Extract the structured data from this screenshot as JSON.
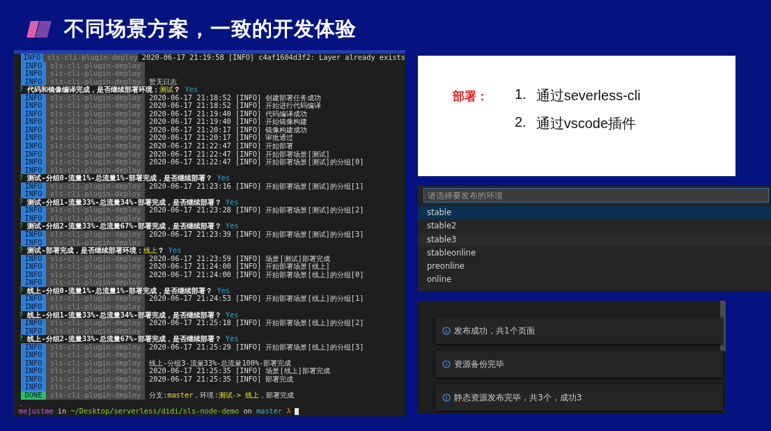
{
  "title": "不同场景方案，一致的开发体验",
  "terminal": {
    "lines": [
      {
        "kind": "log",
        "level": "INFO",
        "source": "sls-cli-plugin-deploy",
        "message": "2020-06-17 21:19:58 [INFO] c4af1604d3f2: Layer already exists"
      },
      {
        "kind": "log",
        "level": "INFO",
        "source": "sls-cli-plugin-deploy"
      },
      {
        "kind": "log",
        "level": "INFO",
        "source": "sls-cli-plugin-deploy"
      },
      {
        "kind": "log",
        "level": "INFO",
        "source": "sls-cli-plugin-deploy",
        "message": "暂无日志"
      },
      {
        "kind": "prompt",
        "segments": [
          {
            "text": "?",
            "kind": "mark"
          },
          {
            "text": " 代码和镜像编译完成，是否继续部署环境：",
            "kind": "question"
          },
          {
            "text": "测试",
            "kind": "env"
          },
          {
            "text": "？",
            "kind": "question"
          },
          {
            "text": " Yes",
            "kind": "answer"
          }
        ]
      },
      {
        "kind": "log",
        "level": "INFO",
        "source": "sls-cli-plugin-deploy",
        "message": "2020-06-17 21:18:52 [INFO] 创建部署任务成功"
      },
      {
        "kind": "log",
        "level": "INFO",
        "source": "sls-cli-plugin-deploy",
        "message": "2020-06-17 21:18:52 [INFO] 开始进行代码编译"
      },
      {
        "kind": "log",
        "level": "INFO",
        "source": "sls-cli-plugin-deploy",
        "message": "2020-06-17 21:19:40 [INFO] 代码编译成功"
      },
      {
        "kind": "log",
        "level": "INFO",
        "source": "sls-cli-plugin-deploy",
        "message": "2020-06-17 21:19:40 [INFO] 开始镜像构建"
      },
      {
        "kind": "log",
        "level": "INFO",
        "source": "sls-cli-plugin-deploy",
        "message": "2020-06-17 21:20:17 [INFO] 镜像构建成功"
      },
      {
        "kind": "log",
        "level": "INFO",
        "source": "sls-cli-plugin-deploy",
        "message": "2020-06-17 21:20:17 [INFO] 审批通过"
      },
      {
        "kind": "log",
        "level": "INFO",
        "source": "sls-cli-plugin-deploy",
        "message": "2020-06-17 21:22:47 [INFO] 开始部署"
      },
      {
        "kind": "log",
        "level": "INFO",
        "source": "sls-cli-plugin-deploy",
        "message": "2020-06-17 21:22:47 [INFO] 开始部署场景[测试]"
      },
      {
        "kind": "log",
        "level": "INFO",
        "source": "sls-cli-plugin-deploy",
        "message": "2020-06-17 21:22:47 [INFO] 开始部署场景[测试]的分组[0]"
      },
      {
        "kind": "log",
        "level": "INFO",
        "source": "sls-cli-plugin-deploy"
      },
      {
        "kind": "prompt",
        "segments": [
          {
            "text": "?",
            "kind": "mark"
          },
          {
            "text": " 测试-分组0-流量1%-总流量1%-部署完成，是否继续部署？",
            "kind": "question"
          },
          {
            "text": " Yes",
            "kind": "answer"
          }
        ]
      },
      {
        "kind": "log",
        "level": "INFO",
        "source": "sls-cli-plugin-deploy",
        "message": "2020-06-17 21:23:16 [INFO] 开始部署场景[测试]的分组[1]"
      },
      {
        "kind": "log",
        "level": "INFO",
        "source": "sls-cli-plugin-deploy"
      },
      {
        "kind": "prompt",
        "segments": [
          {
            "text": "?",
            "kind": "mark"
          },
          {
            "text": " 测试-分组1-流量33%-总流量34%-部署完成，是否继续部署？",
            "kind": "question"
          },
          {
            "text": " Yes",
            "kind": "answer"
          }
        ]
      },
      {
        "kind": "log",
        "level": "INFO",
        "source": "sls-cli-plugin-deploy",
        "message": "2020-06-17 21:23:28 [INFO] 开始部署场景[测试]的分组[2]"
      },
      {
        "kind": "log",
        "level": "INFO",
        "source": "sls-cli-plugin-deploy"
      },
      {
        "kind": "prompt",
        "segments": [
          {
            "text": "?",
            "kind": "mark"
          },
          {
            "text": " 测试-分组2-流量33%-总流量67%-部署完成，是否继续部署？",
            "kind": "question"
          },
          {
            "text": " Yes",
            "kind": "answer"
          }
        ]
      },
      {
        "kind": "log",
        "level": "INFO",
        "source": "sls-cli-plugin-deploy",
        "message": "2020-06-17 21:23:39 [INFO] 开始部署场景[测试]的分组[3]"
      },
      {
        "kind": "log",
        "level": "INFO",
        "source": "sls-cli-plugin-deploy"
      },
      {
        "kind": "prompt",
        "segments": [
          {
            "text": "?",
            "kind": "mark"
          },
          {
            "text": " 测试-部署完成，是否继续部署环境：",
            "kind": "question"
          },
          {
            "text": "线上",
            "kind": "env"
          },
          {
            "text": "？",
            "kind": "question"
          },
          {
            "text": " Yes",
            "kind": "answer"
          }
        ]
      },
      {
        "kind": "log",
        "level": "INFO",
        "source": "sls-cli-plugin-deploy",
        "message": "2020-06-17 21:23:59 [INFO] 场景[测试]部署完成"
      },
      {
        "kind": "log",
        "level": "INFO",
        "source": "sls-cli-plugin-deploy",
        "message": "2020-06-17 21:24:00 [INFO] 开始部署场景[线上]"
      },
      {
        "kind": "log",
        "level": "INFO",
        "source": "sls-cli-plugin-deploy",
        "message": "2020-06-17 21:24:00 [INFO] 开始部署场景[线上]的分组[0]"
      },
      {
        "kind": "log",
        "level": "INFO",
        "source": "sls-cli-plugin-deploy"
      },
      {
        "kind": "prompt",
        "segments": [
          {
            "text": "?",
            "kind": "mark"
          },
          {
            "text": " 线上-分组0-流量1%-总流量1%-部署完成，是否继续部署？",
            "kind": "question"
          },
          {
            "text": " Yes",
            "kind": "answer"
          }
        ]
      },
      {
        "kind": "log",
        "level": "INFO",
        "source": "sls-cli-plugin-deploy",
        "message": "2020-06-17 21:24:53 [INFO] 开始部署场景[线上]的分组[1]"
      },
      {
        "kind": "log",
        "level": "INFO",
        "source": "sls-cli-plugin-deploy"
      },
      {
        "kind": "prompt",
        "segments": [
          {
            "text": "?",
            "kind": "mark"
          },
          {
            "text": " 线上-分组1-流量33%-总流量34%-部署完成，是否继续部署？",
            "kind": "question"
          },
          {
            "text": " Yes",
            "kind": "answer"
          }
        ]
      },
      {
        "kind": "log",
        "level": "INFO",
        "source": "sls-cli-plugin-deploy",
        "message": "2020-06-17 21:25:18 [INFO] 开始部署场景[线上]的分组[2]"
      },
      {
        "kind": "log",
        "level": "INFO",
        "source": "sls-cli-plugin-deploy"
      },
      {
        "kind": "prompt",
        "segments": [
          {
            "text": "?",
            "kind": "mark"
          },
          {
            "text": " 线上-分组2-流量33%-总流量67%-部署完成，是否继续部署？",
            "kind": "question"
          },
          {
            "text": " Yes",
            "kind": "answer"
          }
        ]
      },
      {
        "kind": "log",
        "level": "INFO",
        "source": "sls-cli-plugin-deploy",
        "message": "2020-06-17 21:25:29 [INFO] 开始部署场景[线上]的分组[3]"
      },
      {
        "kind": "log",
        "level": "INFO",
        "source": "sls-cli-plugin-deploy"
      },
      {
        "kind": "log",
        "level": "INFO",
        "source": "sls-cli-plugin-deploy",
        "message": "线上-分组3-流量33%-总流量100%-部署完成"
      },
      {
        "kind": "log",
        "level": "INFO",
        "source": "sls-cli-plugin-deploy",
        "message": "2020-06-17 21:25:35 [INFO] 场景[线上]部署完成"
      },
      {
        "kind": "log",
        "level": "INFO",
        "source": "sls-cli-plugin-deploy",
        "message": "2020-06-17 21:25:35 [INFO] 部署完成"
      },
      {
        "kind": "log",
        "level": "INFO",
        "source": "sls-cli-plugin-deploy"
      },
      {
        "kind": "log",
        "level": "DONE",
        "source": "sls-cli-plugin-deploy",
        "segments": [
          {
            "text": "分支:",
            "kind": "plain"
          },
          {
            "text": "master",
            "kind": "env"
          },
          {
            "text": "，环境:",
            "kind": "plain"
          },
          {
            "text": "测试-> 线上",
            "kind": "env"
          },
          {
            "text": "，部署完成",
            "kind": "plain"
          }
        ]
      },
      {
        "kind": "text",
        "segments": [
          {
            "text": ".",
            "kind": "branch"
          }
        ]
      },
      {
        "kind": "shell",
        "segments": [
          {
            "text": "mejustme",
            "kind": "user"
          },
          {
            "text": " in ",
            "kind": "plain"
          },
          {
            "text": "~/Desktop/serverless/didi/sls-node-demo",
            "kind": "path"
          },
          {
            "text": " on ",
            "kind": "plain"
          },
          {
            "text": "master",
            "kind": "branch"
          },
          {
            "text": " λ",
            "kind": "lambda"
          }
        ]
      }
    ]
  },
  "card": {
    "label": "部署：",
    "items": [
      {
        "number": "1.",
        "text": "通过severless-cli"
      },
      {
        "number": "2.",
        "text": "通过vscode插件"
      }
    ]
  },
  "quick_pick": {
    "placeholder": "请选择要发布的环境",
    "items": [
      {
        "label": "stable",
        "selected": true
      },
      {
        "label": "stable2",
        "selected": false
      },
      {
        "label": "stable3",
        "selected": false
      },
      {
        "label": "stableonline",
        "selected": false
      },
      {
        "label": "preonline",
        "selected": false
      },
      {
        "label": "online",
        "selected": false
      }
    ]
  },
  "notifications": [
    {
      "message": "发布成功，共1个页面"
    },
    {
      "message": "资源备份完毕"
    },
    {
      "message": "静态资源发布完毕，共3个，成功3"
    }
  ]
}
